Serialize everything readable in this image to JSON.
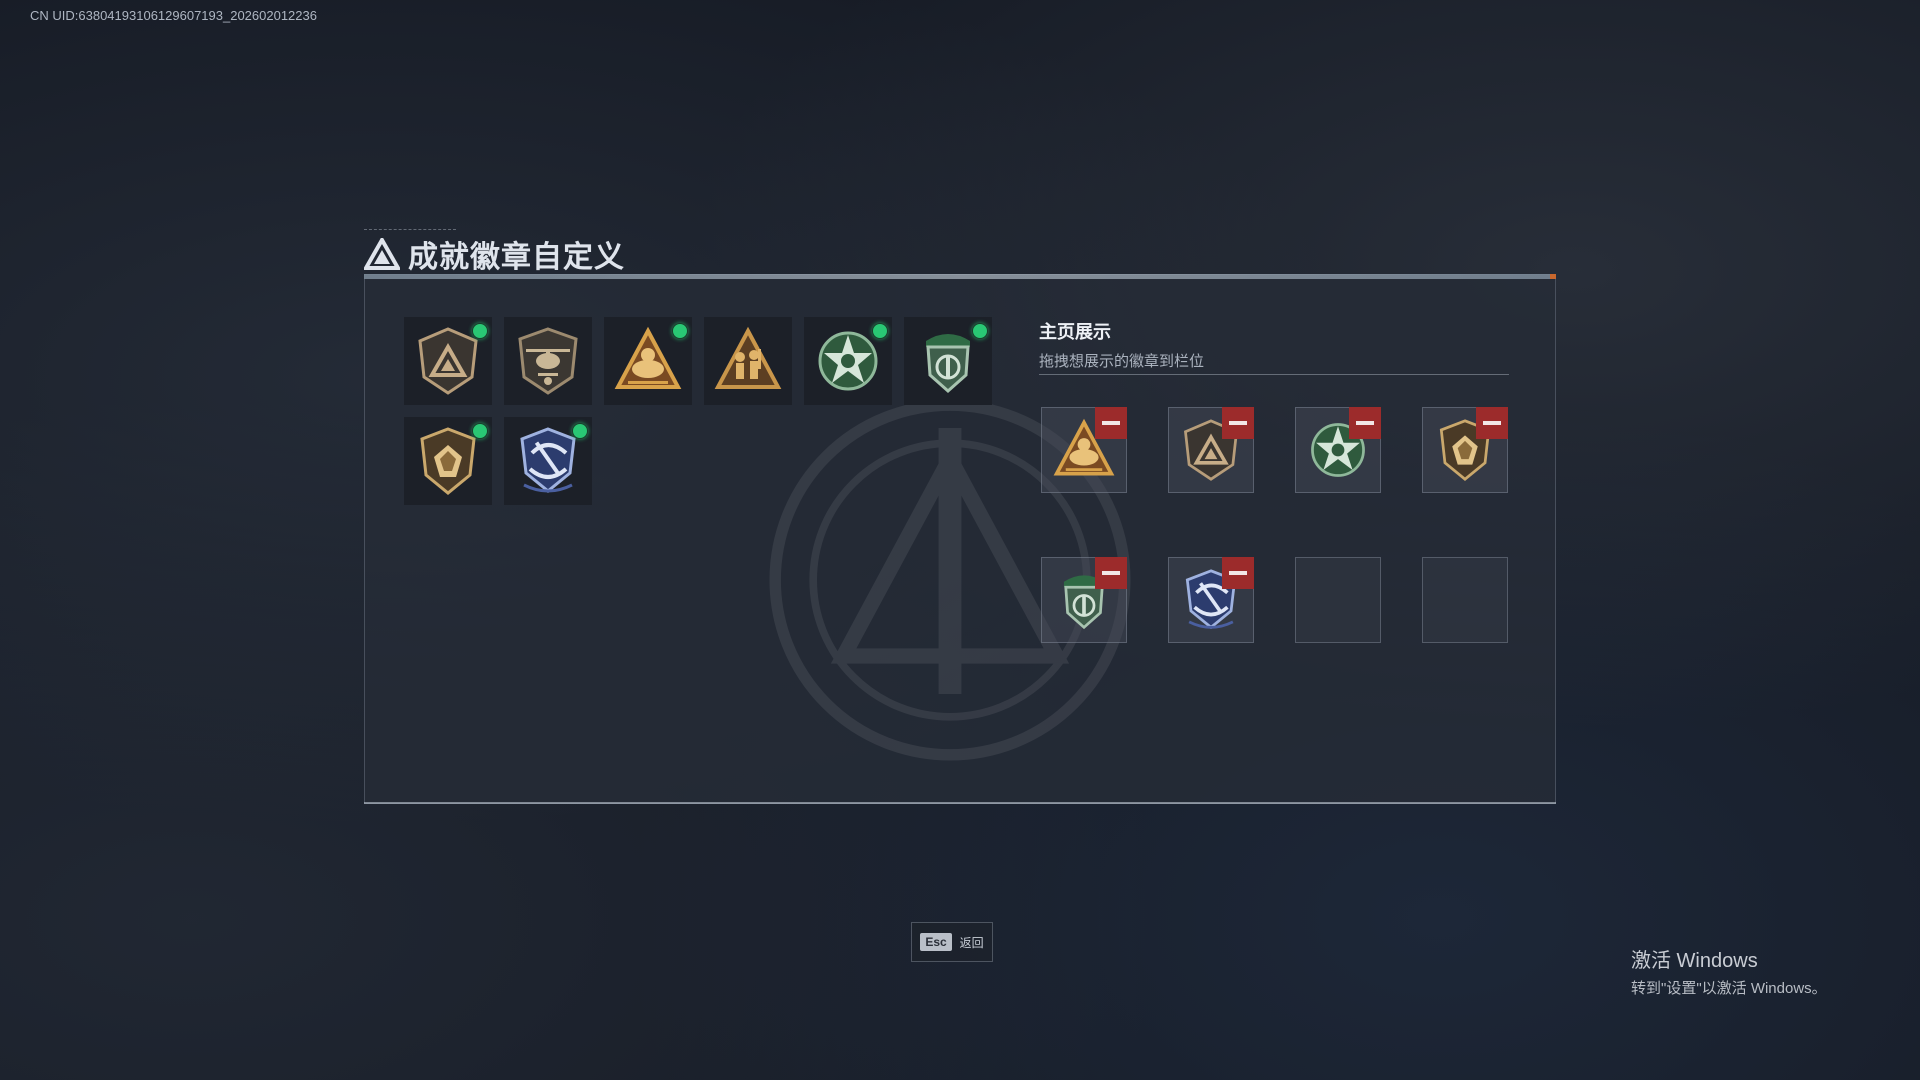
{
  "uid_text": "CN UID:63804193106129607193_202602012236",
  "header": {
    "title": "成就徽章自定义"
  },
  "inventory": {
    "badges": [
      {
        "icon": "bronze-shield-triangle-badge",
        "new": true
      },
      {
        "icon": "helicopter-shield-badge",
        "new": false
      },
      {
        "icon": "gold-triangle-eye-badge",
        "new": true
      },
      {
        "icon": "gold-triangle-soldiers-badge",
        "new": false
      },
      {
        "icon": "green-star-cross-badge",
        "new": true
      },
      {
        "icon": "green-beret-shield-badge",
        "new": true
      },
      {
        "icon": "gold-shield-gem-badge",
        "new": true
      },
      {
        "icon": "blue-shield-sword-badge",
        "new": true
      }
    ]
  },
  "display": {
    "title": "主页展示",
    "subtitle": "拖拽想展示的徽章到栏位",
    "slots": [
      {
        "icon": "gold-triangle-eye-badge",
        "filled": true
      },
      {
        "icon": "bronze-shield-triangle-badge",
        "filled": true
      },
      {
        "icon": "green-star-cross-badge",
        "filled": true
      },
      {
        "icon": "gold-shield-gem-badge",
        "filled": true
      },
      {
        "icon": "green-beret-shield-badge",
        "filled": true
      },
      {
        "icon": "blue-shield-sword-badge",
        "filled": true
      },
      {
        "icon": "",
        "filled": false
      },
      {
        "icon": "",
        "filled": false
      }
    ]
  },
  "footer": {
    "esc_key": "Esc",
    "esc_label": "返回"
  },
  "windows_activation": {
    "title": "激活 Windows",
    "subtitle": "转到\"设置\"以激活 Windows。"
  },
  "colors": {
    "new_dot": "#29c774",
    "remove_button": "#9c2b2b",
    "panel_accent": "#c9682e"
  }
}
